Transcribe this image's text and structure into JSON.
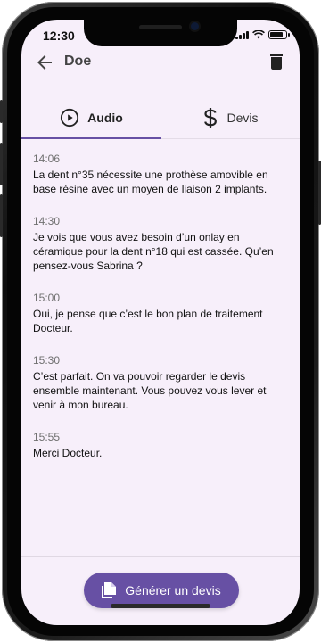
{
  "status_bar": {
    "time": "12:30"
  },
  "app_bar": {
    "title": "Doe",
    "back_icon": "arrow-left-icon",
    "delete_icon": "trash-icon"
  },
  "tabs": [
    {
      "label": "Audio",
      "icon": "play-circle-icon",
      "selected": true
    },
    {
      "label": "Devis",
      "icon": "dollar-icon",
      "selected": false
    }
  ],
  "transcript": [
    {
      "time": "14:06",
      "text": "La dent n°35 nécessite une prothèse amovible en base résine avec un moyen de liaison 2 implants."
    },
    {
      "time": "14:30",
      "text": "Je vois que vous avez besoin d’un onlay en céramique pour la dent n°18 qui est cassée. Qu’en pensez-vous Sabrina ?"
    },
    {
      "time": "15:00",
      "text": "Oui, je pense que c’est le bon plan de traitement Docteur."
    },
    {
      "time": "15:30",
      "text": "C’est parfait. On va pouvoir regarder le devis ensemble maintenant. Vous pouvez vous lever et venir à mon bureau."
    },
    {
      "time": "15:55",
      "text": "Merci Docteur."
    }
  ],
  "action": {
    "label": "Générer un devis",
    "icon": "document-copy-icon"
  },
  "colors": {
    "accent": "#6750a4",
    "background": "#f7effa",
    "text": "#111111",
    "muted": "#707070"
  }
}
